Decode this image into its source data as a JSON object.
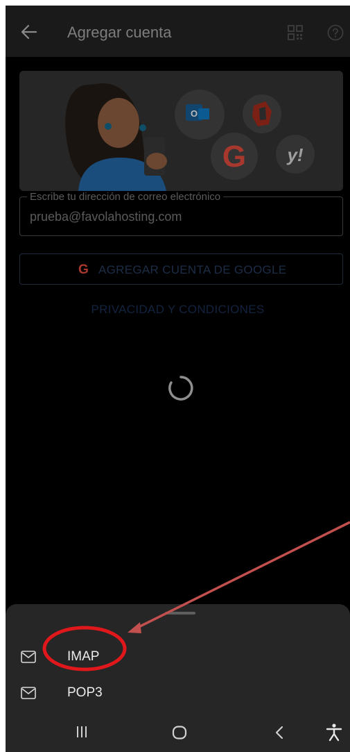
{
  "app_bar": {
    "title": "Agregar cuenta",
    "back_icon": "arrow-left-icon",
    "qr_icon": "qr-code-icon",
    "help_icon": "help-circle-icon"
  },
  "hero": {
    "providers": [
      "Outlook",
      "Office",
      "Google",
      "Yahoo"
    ]
  },
  "email_field": {
    "label": "Escribe tu dirección de correo electrónico",
    "value": "prueba@favolahosting.com"
  },
  "google_button": {
    "icon": "G",
    "label": "AGREGAR CUENTA DE GOOGLE"
  },
  "privacy_link": "PRIVACIDAD Y CONDICIONES",
  "loading": {
    "icon": "spinner-icon"
  },
  "sheet": {
    "items": [
      {
        "label": "IMAP",
        "icon": "mail-icon"
      },
      {
        "label": "POP3",
        "icon": "mail-icon"
      }
    ]
  },
  "nav_bar": {
    "icons": [
      "recent-apps-icon",
      "home-icon",
      "back-icon",
      "accessibility-icon"
    ]
  },
  "colors": {
    "background": "#000000",
    "sheet": "#262626",
    "annotation_red": "#e0181c",
    "arrow": "#c2504e"
  }
}
